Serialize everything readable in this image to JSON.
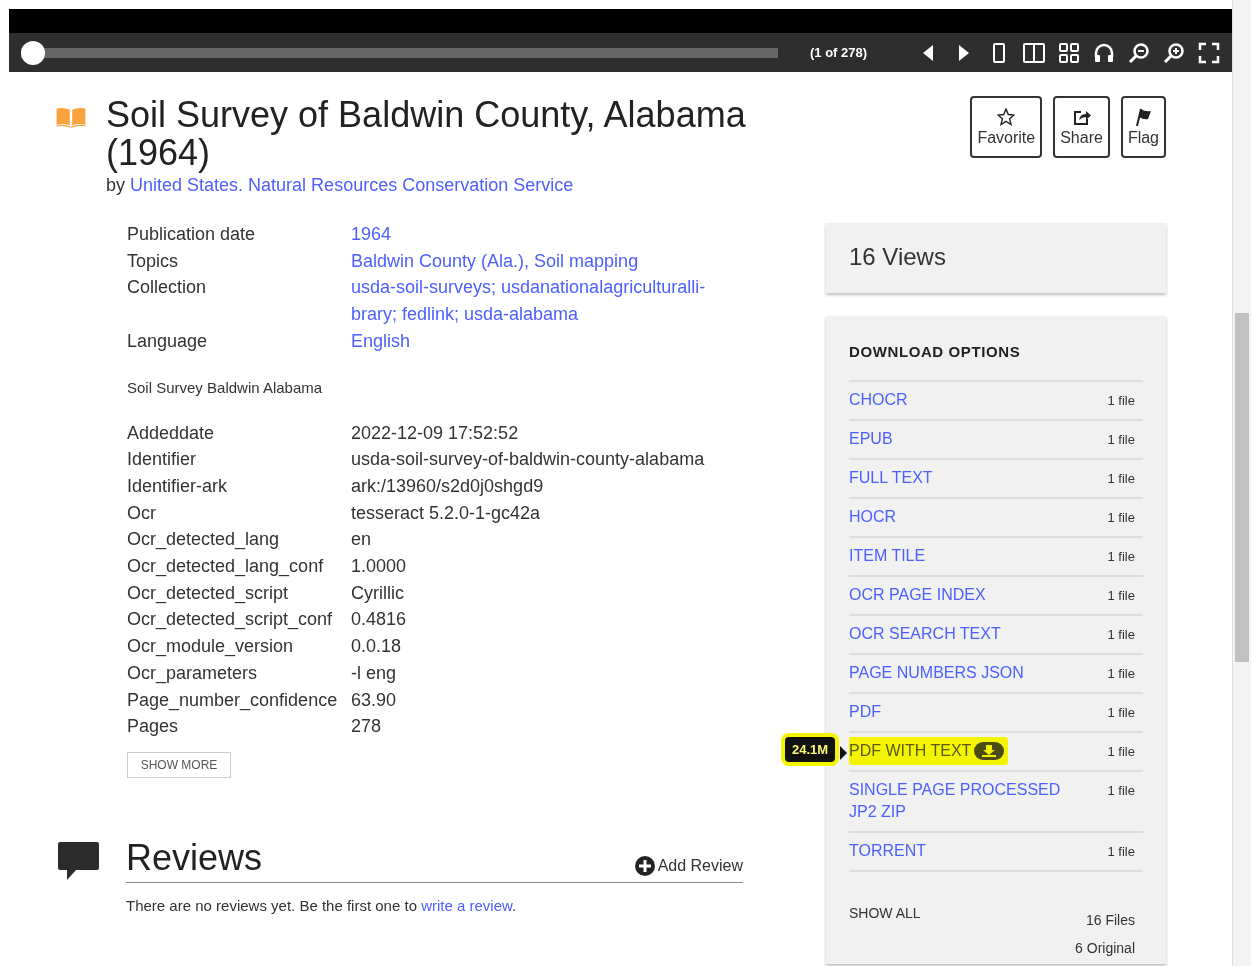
{
  "viewer": {
    "page_slider": {
      "level": 0
    },
    "page_indicator": "(1 of 278)"
  },
  "item": {
    "title": "Soil Survey of Baldwin County, Alabama (1964)",
    "by": "by",
    "creator": "United States. Natural Resources Conservation Service"
  },
  "actions": [
    "Favorite",
    "Share",
    "Flag"
  ],
  "metadata": [
    {
      "label": "Publication date",
      "value": "1964",
      "kind": "link"
    },
    {
      "label": "Topics",
      "value": "Baldwin County (Ala.), Soil mapping",
      "kind": "link"
    },
    {
      "label": "Collection",
      "value": "usda-soil-surveys; usdanationalagriculturalli-brary; fedlink; usda-alabama",
      "kind": "link"
    },
    {
      "label": "Language",
      "value": "English",
      "kind": "link"
    }
  ],
  "description": "Soil Survey Baldwin Alabama",
  "details": [
    {
      "label": "Addeddate",
      "value": "2022-12-09 17:52:52"
    },
    {
      "label": "Identifier",
      "value": "usda-soil-survey-of-baldwin-county-alabama"
    },
    {
      "label": "Identifier-ark",
      "value": "ark:/13960/s2d0j0shgd9"
    },
    {
      "label": "Ocr",
      "value": "tesseract 5.2.0-1-gc42a"
    },
    {
      "label": "Ocr_detected_lang",
      "value": "en"
    },
    {
      "label": "Ocr_detected_lang_conf",
      "value": "1.0000"
    },
    {
      "label": "Ocr_detected_script",
      "value": "Cyrillic"
    },
    {
      "label": "Ocr_detected_script_conf",
      "value": "0.4816"
    },
    {
      "label": "Ocr_module_version",
      "value": "0.0.18"
    },
    {
      "label": "Ocr_parameters",
      "value": "-l eng"
    },
    {
      "label": "Page_number_confidence",
      "value": "63.90"
    },
    {
      "label": "Pages",
      "value": "278"
    }
  ],
  "show_more": "SHOW MORE",
  "views": "16 Views",
  "downloads": {
    "title": "DOWNLOAD OPTIONS",
    "files": [
      {
        "format": "CHOCR",
        "count": "1 file",
        "highlighted": false,
        "hovered": false
      },
      {
        "format": "EPUB",
        "count": "1 file",
        "highlighted": false,
        "hovered": false
      },
      {
        "format": "FULL TEXT",
        "count": "1 file",
        "highlighted": false,
        "hovered": false
      },
      {
        "format": "HOCR",
        "count": "1 file",
        "highlighted": false,
        "hovered": false
      },
      {
        "format": "ITEM TILE",
        "count": "1 file",
        "highlighted": false,
        "hovered": false
      },
      {
        "format": "OCR PAGE INDEX",
        "count": "1 file",
        "highlighted": false,
        "hovered": false
      },
      {
        "format": "OCR SEARCH TEXT",
        "count": "1 file",
        "highlighted": false,
        "hovered": false
      },
      {
        "format": "PAGE NUMBERS JSON",
        "count": "1 file",
        "highlighted": false,
        "hovered": false
      },
      {
        "format": "PDF",
        "count": "1 file",
        "highlighted": false,
        "hovered": false
      },
      {
        "format": "PDF WITH TEXT",
        "count": "1 file",
        "highlighted": true,
        "hovered": true,
        "tooltip": "24.1M"
      },
      {
        "format": "SINGLE PAGE PROCESSED JP2 ZIP",
        "count": "1 file",
        "highlighted": false,
        "hovered": false
      },
      {
        "format": "TORRENT",
        "count": "1 file",
        "highlighted": false,
        "hovered": false
      }
    ],
    "show_all": "SHOW ALL",
    "total": "16 Files",
    "original": "6 Original"
  },
  "reviews": {
    "title": "Reviews",
    "add": "Add Review",
    "empty_text": "There are no reviews yet. Be the first one to ",
    "link": "write a review",
    "end": "."
  }
}
